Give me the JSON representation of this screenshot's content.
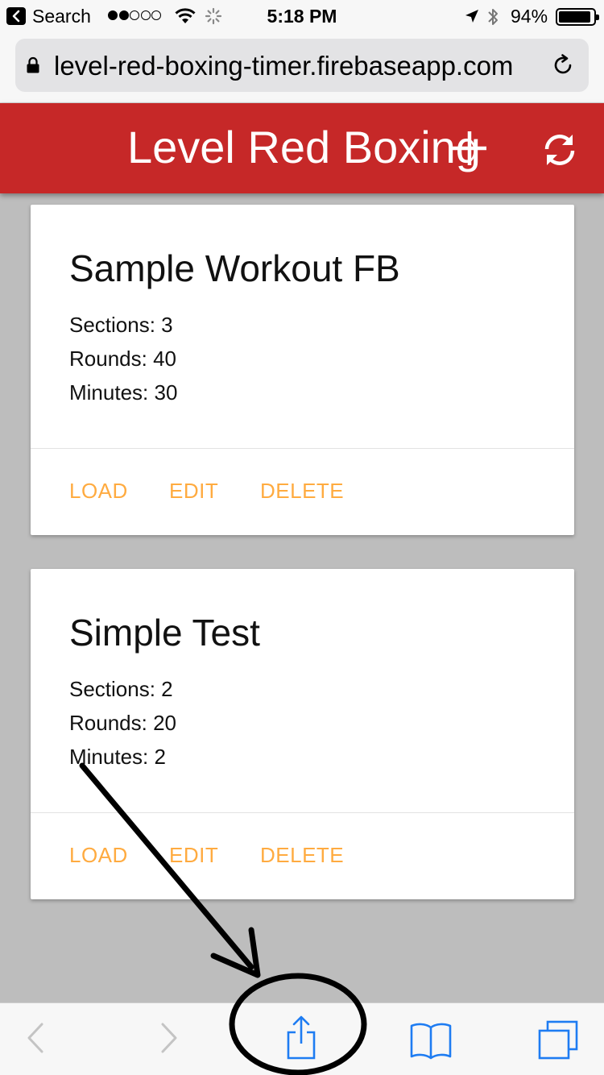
{
  "status_bar": {
    "carrier": "Search",
    "time": "5:18 PM",
    "battery_text": "94%",
    "battery_level": 0.94,
    "signal_bars": 2,
    "signal_total": 5
  },
  "browser": {
    "url": "level-red-boxing-timer.firebaseapp.com"
  },
  "app": {
    "title": "Level Red Boxing",
    "color": "#c62828",
    "accent": "#ffab40"
  },
  "workouts": [
    {
      "name": "Sample Workout FB",
      "sections": "Sections: 3",
      "rounds": "Rounds: 40",
      "minutes": "Minutes: 30",
      "actions": {
        "load": "LOAD",
        "edit": "EDIT",
        "delete": "DELETE"
      }
    },
    {
      "name": "Simple Test",
      "sections": "Sections: 2",
      "rounds": "Rounds: 20",
      "minutes": "Minutes: 2",
      "actions": {
        "load": "LOAD",
        "edit": "EDIT",
        "delete": "DELETE"
      }
    }
  ],
  "toolbar": {
    "icons": [
      "back-icon",
      "forward-icon",
      "share-icon",
      "bookmarks-icon",
      "tabs-icon"
    ]
  },
  "annotation": {
    "type": "arrow-to-circle",
    "target": "share-icon",
    "color": "#000000"
  }
}
